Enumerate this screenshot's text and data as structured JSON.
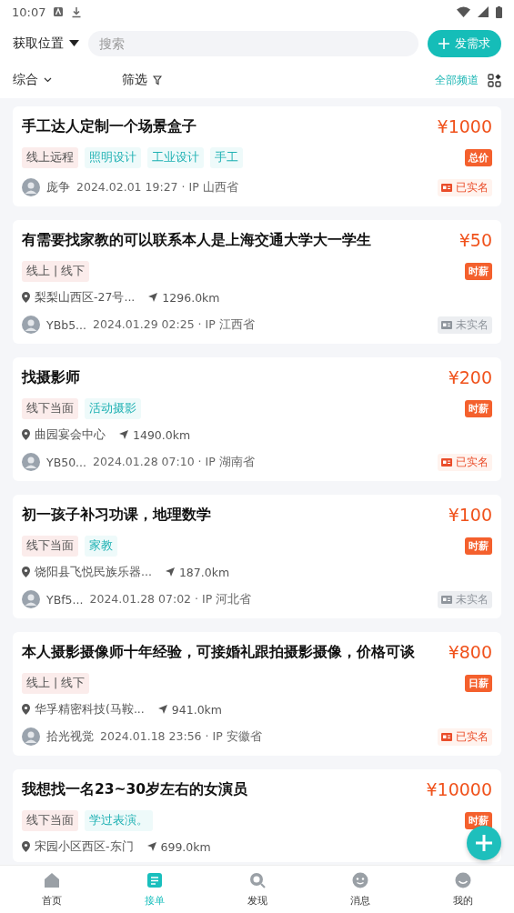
{
  "status_bar": {
    "time": "10:07"
  },
  "header": {
    "location_button": "获取位置",
    "search": {
      "placeholder": "搜索"
    },
    "post_button": "发需求"
  },
  "filters": {
    "sort": "综合",
    "filter": "筛选",
    "channels": "全部频道"
  },
  "posts": [
    {
      "title": "手工达人定制一个场景盒子",
      "price": "¥1000",
      "pay_type": "总价",
      "tags": [
        {
          "label": "线上远程",
          "kind": "mode"
        },
        {
          "label": "照明设计",
          "kind": "skill"
        },
        {
          "label": "工业设计",
          "kind": "skill"
        },
        {
          "label": "手工",
          "kind": "skill"
        }
      ],
      "user": "庞争",
      "time": "2024.02.01 19:27 · IP 山西省",
      "verified": true,
      "verified_label": "已实名"
    },
    {
      "title": "有需要找家教的可以联系本人是上海交通大学大一学生",
      "price": "¥50",
      "pay_type": "时薪",
      "tags": [
        {
          "label": "线上 | 线下",
          "kind": "mode"
        }
      ],
      "place": "梨梨山西区-27号...",
      "distance": "1296.0km",
      "user": "YBb5...",
      "time": "2024.01.29 02:25 · IP 江西省",
      "verified": false,
      "verified_label": "未实名"
    },
    {
      "title": "找摄影师",
      "price": "¥200",
      "pay_type": "时薪",
      "tags": [
        {
          "label": "线下当面",
          "kind": "mode"
        },
        {
          "label": "活动摄影",
          "kind": "skill"
        }
      ],
      "place": "曲园宴会中心",
      "distance": "1490.0km",
      "user": "YB50...",
      "time": "2024.01.28 07:10 · IP 湖南省",
      "verified": true,
      "verified_label": "已实名"
    },
    {
      "title": "初一孩子补习功课，地理数学",
      "price": "¥100",
      "pay_type": "时薪",
      "tags": [
        {
          "label": "线下当面",
          "kind": "mode"
        },
        {
          "label": "家教",
          "kind": "skill"
        }
      ],
      "place": "饶阳县飞悦民族乐器...",
      "distance": "187.0km",
      "user": "YBf5...",
      "time": "2024.01.28 07:02 · IP 河北省",
      "verified": false,
      "verified_label": "未实名"
    },
    {
      "title": "本人摄影摄像师十年经验，可接婚礼跟拍摄影摄像，价格可谈",
      "price": "¥800",
      "pay_type": "日薪",
      "tags": [
        {
          "label": "线上 | 线下",
          "kind": "mode"
        }
      ],
      "place": "华孚精密科技(马鞍...",
      "distance": "941.0km",
      "user": "拾光视觉",
      "time": "2024.01.18 23:56 · IP 安徽省",
      "verified": true,
      "verified_label": "已实名"
    },
    {
      "title": "我想找一名23~30岁左右的女演员",
      "price": "¥10000",
      "pay_type": "时薪",
      "tags": [
        {
          "label": "线下当面",
          "kind": "mode"
        },
        {
          "label": "学过表演。",
          "kind": "skill"
        }
      ],
      "place": "宋园小区西区-东门",
      "distance": "699.0km"
    }
  ],
  "tab_bar": [
    {
      "label": "首页",
      "selected": false,
      "kind": "home"
    },
    {
      "label": "接单",
      "selected": true,
      "kind": "orders"
    },
    {
      "label": "发现",
      "selected": false,
      "kind": "discover"
    },
    {
      "label": "消息",
      "selected": false,
      "kind": "messages"
    },
    {
      "label": "我的",
      "selected": false,
      "kind": "profile"
    }
  ]
}
